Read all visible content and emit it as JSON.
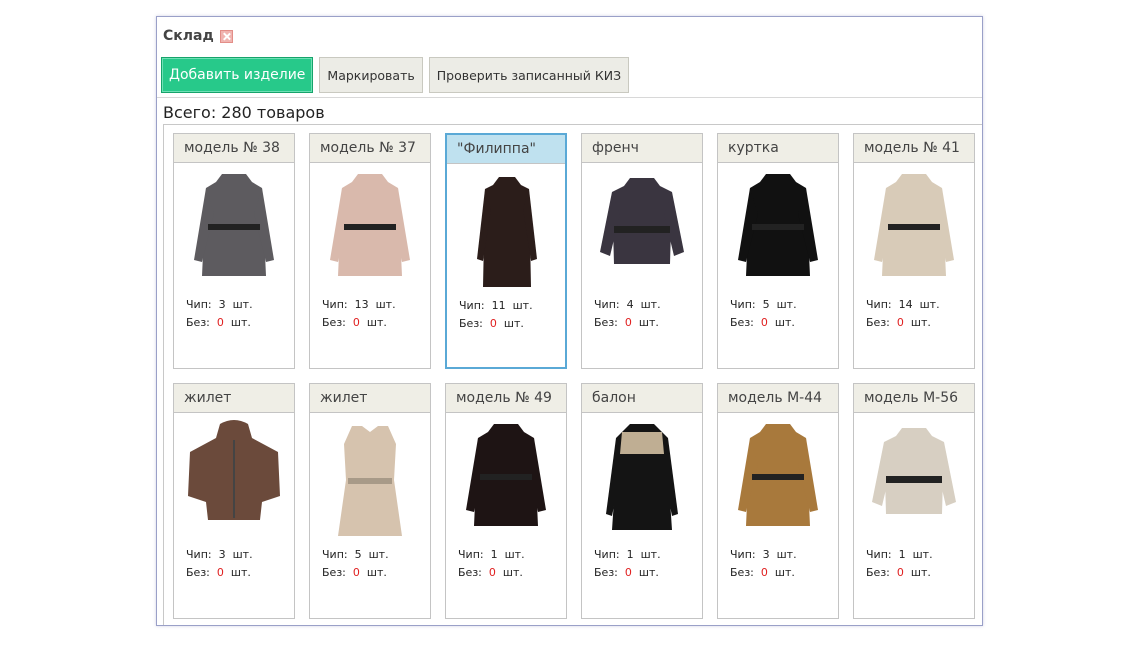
{
  "window": {
    "title": "Склад",
    "close_icon": "close-icon"
  },
  "toolbar": {
    "add_label": "Добавить изделие",
    "mark_label": "Маркировать",
    "check_label": "Проверить записанный КИЗ"
  },
  "total_text": "Всего: 280 товаров",
  "labels": {
    "chip": "Чип:",
    "without": "Без:",
    "unit": "шт."
  },
  "products": [
    {
      "name": "модель № 38",
      "chip": "3",
      "without": "0",
      "color": "#5d5b5f",
      "shape": "coat"
    },
    {
      "name": "модель № 37",
      "chip": "13",
      "without": "0",
      "color": "#d9b9ac",
      "shape": "coat"
    },
    {
      "name": "\"Филиппа\"",
      "chip": "11",
      "without": "0",
      "color": "#2b1d1a",
      "shape": "longcoat",
      "selected": true
    },
    {
      "name": "френч",
      "chip": "4",
      "without": "0",
      "color": "#3a3540",
      "shape": "jacket"
    },
    {
      "name": "куртка",
      "chip": "5",
      "without": "0",
      "color": "#111111",
      "shape": "coat"
    },
    {
      "name": "модель № 41",
      "chip": "14",
      "without": "0",
      "color": "#d8cbb8",
      "shape": "coat"
    },
    {
      "name": "жилет",
      "chip": "3",
      "without": "0",
      "color": "#6b4a3b",
      "shape": "cape"
    },
    {
      "name": "жилет",
      "chip": "5",
      "without": "0",
      "color": "#d6c3ae",
      "shape": "vest"
    },
    {
      "name": "модель № 49",
      "chip": "1",
      "without": "0",
      "color": "#1e1414",
      "shape": "coat"
    },
    {
      "name": "балон",
      "chip": "1",
      "without": "0",
      "color": "#141414",
      "shape": "dress"
    },
    {
      "name": "модель М-44",
      "chip": "3",
      "without": "0",
      "color": "#a8793c",
      "shape": "coat"
    },
    {
      "name": "модель М-56",
      "chip": "1",
      "without": "0",
      "color": "#d7cfc2",
      "shape": "jacket"
    }
  ]
}
